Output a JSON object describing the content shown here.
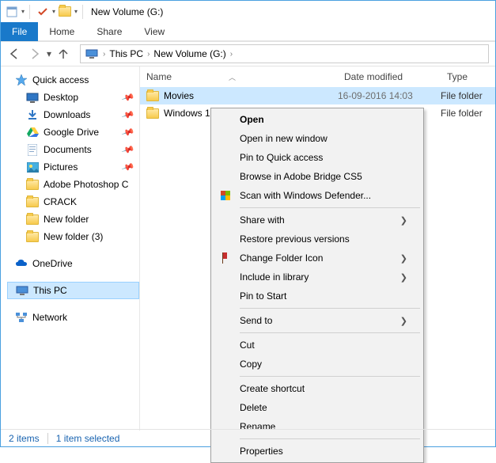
{
  "title": "New Volume (G:)",
  "ribbon": {
    "file": "File",
    "tabs": [
      "Home",
      "Share",
      "View"
    ]
  },
  "breadcrumb": [
    "This PC",
    "New Volume (G:)"
  ],
  "columns": {
    "name": "Name",
    "date": "Date modified",
    "type": "Type"
  },
  "tree": {
    "quick_access": "Quick access",
    "items": [
      {
        "label": "Desktop",
        "pin": true
      },
      {
        "label": "Downloads",
        "pin": true
      },
      {
        "label": "Google Drive",
        "pin": true
      },
      {
        "label": "Documents",
        "pin": true
      },
      {
        "label": "Pictures",
        "pin": true
      },
      {
        "label": "Adobe Photoshop C",
        "pin": false
      },
      {
        "label": "CRACK",
        "pin": false
      },
      {
        "label": "New folder",
        "pin": false
      },
      {
        "label": "New folder (3)",
        "pin": false
      }
    ],
    "onedrive": "OneDrive",
    "thispc": "This PC",
    "network": "Network"
  },
  "rows": [
    {
      "name": "Movies",
      "date": "16-09-2016 14:03",
      "type": "File folder",
      "selected": true
    },
    {
      "name": "Windows 1",
      "date": "",
      "type": "File folder",
      "selected": false
    }
  ],
  "ctx": [
    {
      "label": "Open",
      "bold": true
    },
    {
      "label": "Open in new window"
    },
    {
      "label": "Pin to Quick access"
    },
    {
      "label": "Browse in Adobe Bridge CS5"
    },
    {
      "label": "Scan with Windows Defender...",
      "icon": "shield"
    },
    {
      "sep": true
    },
    {
      "label": "Share with",
      "sub": true
    },
    {
      "label": "Restore previous versions"
    },
    {
      "label": "Change Folder Icon",
      "sub": true,
      "icon": "redflag"
    },
    {
      "label": "Include in library",
      "sub": true
    },
    {
      "label": "Pin to Start"
    },
    {
      "sep": true
    },
    {
      "label": "Send to",
      "sub": true
    },
    {
      "sep": true
    },
    {
      "label": "Cut"
    },
    {
      "label": "Copy"
    },
    {
      "sep": true
    },
    {
      "label": "Create shortcut"
    },
    {
      "label": "Delete"
    },
    {
      "label": "Rename"
    },
    {
      "sep": true
    },
    {
      "label": "Properties"
    }
  ],
  "status": {
    "count": "2 items",
    "selected": "1 item selected"
  }
}
